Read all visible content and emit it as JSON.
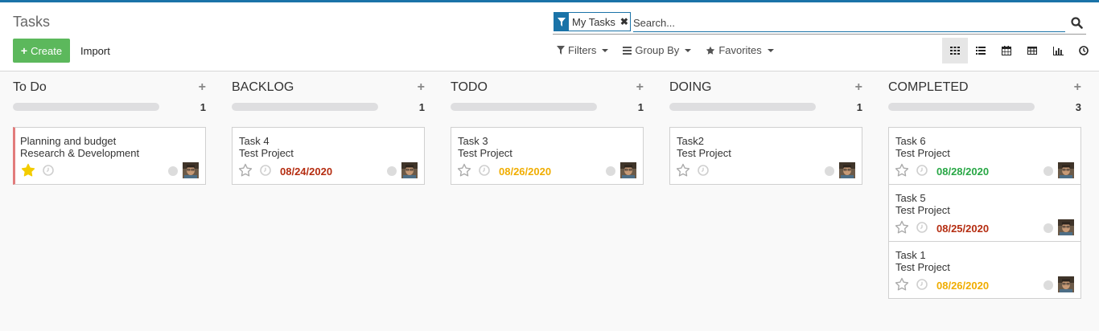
{
  "app": {
    "title": "Tasks"
  },
  "toolbar": {
    "create_label": "Create",
    "import_label": "Import"
  },
  "search": {
    "facet_value": "My Tasks",
    "placeholder": "Search..."
  },
  "filters": {
    "filters_label": "Filters",
    "groupby_label": "Group By",
    "favorites_label": "Favorites"
  },
  "views": [
    "kanban",
    "list",
    "calendar",
    "pivot",
    "graph",
    "activity"
  ],
  "colors": {
    "accent": "#1a73a8",
    "create": "#5cb85c",
    "star": "#f3cc00",
    "red": "#b52d11",
    "yellow": "#f0ad00",
    "green": "#28a745"
  },
  "columns": [
    {
      "title": "To Do",
      "count": "1",
      "cards": [
        {
          "name": "Planning and budget",
          "project": "Research & Development",
          "date": "",
          "starred": true,
          "color": ""
        }
      ]
    },
    {
      "title": "BACKLOG",
      "count": "1",
      "cards": [
        {
          "name": "Task 4",
          "project": "Test Project",
          "date": "08/24/2020",
          "starred": false,
          "color": "red"
        }
      ]
    },
    {
      "title": "TODO",
      "count": "1",
      "cards": [
        {
          "name": "Task 3",
          "project": "Test Project",
          "date": "08/26/2020",
          "starred": false,
          "color": "yellow"
        }
      ]
    },
    {
      "title": "DOING",
      "count": "1",
      "cards": [
        {
          "name": "Task2",
          "project": "Test Project",
          "date": "",
          "starred": false,
          "color": ""
        }
      ]
    },
    {
      "title": "COMPLETED",
      "count": "3",
      "cards": [
        {
          "name": "Task 6",
          "project": "Test Project",
          "date": "08/28/2020",
          "starred": false,
          "color": "green"
        },
        {
          "name": "Task 5",
          "project": "Test Project",
          "date": "08/25/2020",
          "starred": false,
          "color": "red"
        },
        {
          "name": "Task 1",
          "project": "Test Project",
          "date": "08/26/2020",
          "starred": false,
          "color": "yellow"
        }
      ]
    }
  ]
}
